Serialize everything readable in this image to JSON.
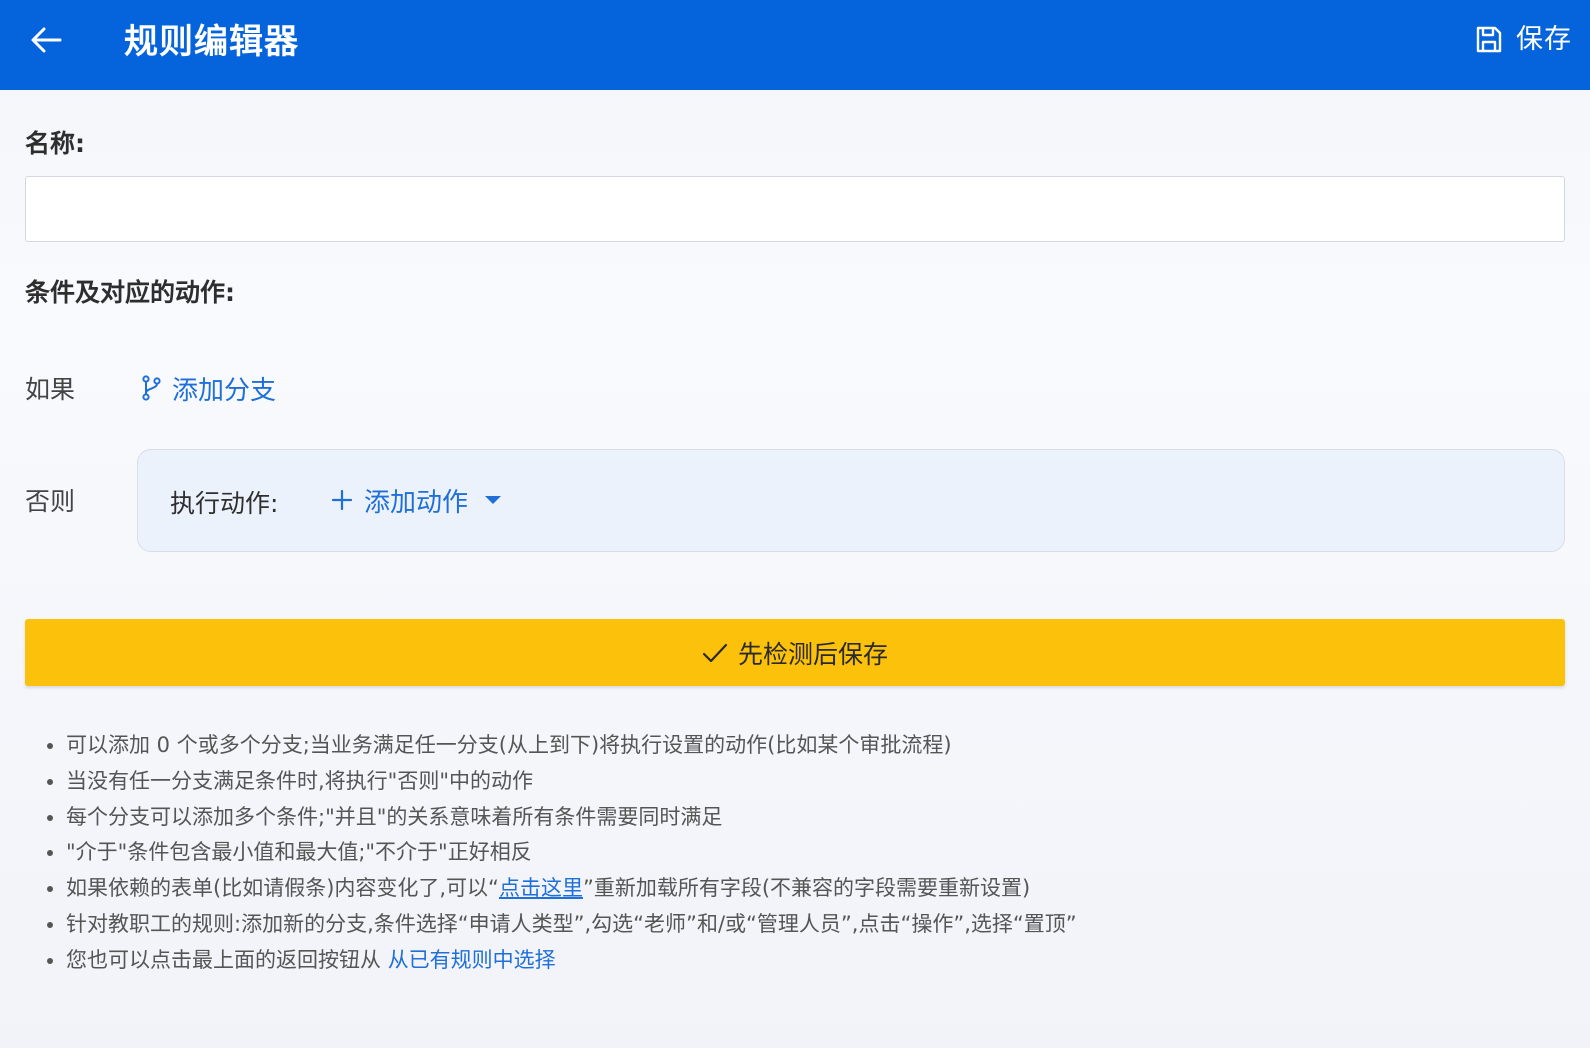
{
  "header": {
    "title": "规则编辑器",
    "save_label": "保存"
  },
  "form": {
    "name_label": "名称:",
    "name_value": "",
    "name_placeholder": "",
    "conditions_label": "条件及对应的动作:"
  },
  "branches": {
    "if_label": "如果",
    "add_branch_label": "添加分支",
    "else_label": "否则",
    "execute_label": "执行动作:",
    "add_action_label": "添加动作"
  },
  "submit": {
    "label": "先检测后保存"
  },
  "tips": {
    "t1": "可以添加 0 个或多个分支;当业务满足任一分支(从上到下)将执行设置的动作(比如某个审批流程)",
    "t2": "当没有任一分支满足条件时,将执行\"否则\"中的动作",
    "t3": "每个分支可以添加多个条件;\"并且\"的关系意味着所有条件需要同时满足",
    "t4": "\"介于\"条件包含最小值和最大值;\"不介于\"正好相反",
    "t5_before": "如果依赖的表单(比如请假条)内容变化了,可以“",
    "t5_link": "点击这里",
    "t5_after": "”重新加载所有字段(不兼容的字段需要重新设置)",
    "t6": "针对教职工的规则:添加新的分支,条件选择“申请人类型”,勾选“老师”和/或“管理人员”,点击“操作”,选择“置顶”",
    "t7_before": "您也可以点击最上面的返回按钮从 ",
    "t7_link": "从已有规则中选择"
  },
  "icons": {
    "back": "arrow-left-icon",
    "save": "floppy-disk-icon",
    "branch": "git-branch-icon",
    "plus": "plus-icon",
    "caret": "caret-down-icon",
    "check": "check-icon"
  },
  "colors": {
    "header_bg": "#0564dc",
    "accent": "#1f6fd8",
    "primary_button": "#fcc10a",
    "else_box_bg": "#ecf2fc"
  }
}
